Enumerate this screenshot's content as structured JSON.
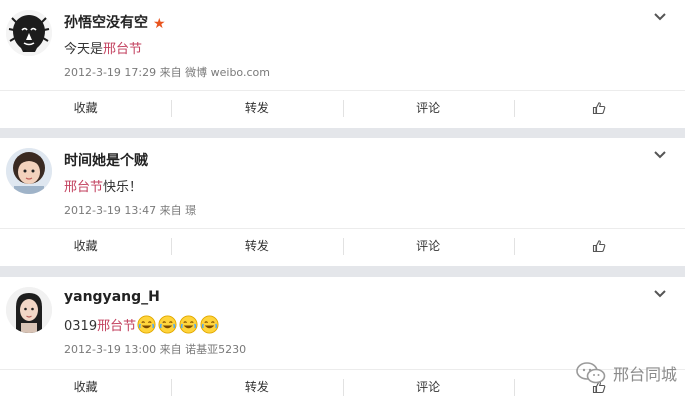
{
  "posts": [
    {
      "username": "孙悟空没有空",
      "verified_star": "★",
      "text_before": "今天是",
      "topic": "邢台节",
      "text_after": "",
      "timestamp": "2012-3-19 17:29",
      "source_prefix": "来自",
      "source": "微博 weibo.com",
      "avatar_icon": "lion-avatar-icon"
    },
    {
      "username": "时间她是个贼",
      "text_before": "",
      "topic": "邢台节",
      "text_after": "快乐！",
      "timestamp": "2012-3-19 13:47",
      "source_prefix": "来自",
      "source": "璟",
      "avatar_icon": "girl-avatar-icon"
    },
    {
      "username": "yangyang_H",
      "text_before": "0319",
      "topic": "邢台节",
      "text_after": "",
      "emoji_count": 4,
      "timestamp": "2012-3-19 13:00",
      "source_prefix": "来自",
      "source": "诺基亚5230",
      "avatar_icon": "woman-avatar-icon"
    }
  ],
  "actions": {
    "favorite": "收藏",
    "repost": "转发",
    "comment": "评论",
    "like_icon": "thumbs-up-icon",
    "menu_icon": "chevron-down-icon"
  },
  "watermark": {
    "text": "邢台同城",
    "icon": "wechat-icon"
  },
  "colors": {
    "topic": "#c23f5d",
    "star": "#e8541e",
    "separator": "#e4e6ea"
  }
}
